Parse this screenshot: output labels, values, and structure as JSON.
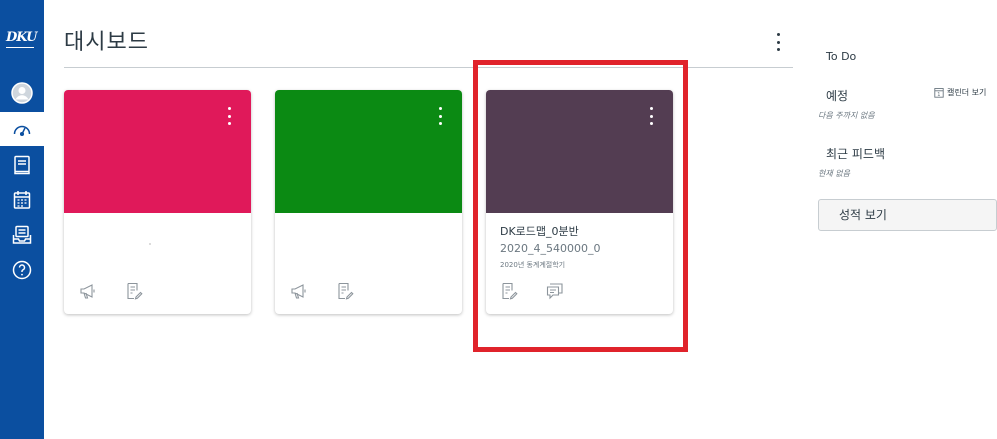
{
  "nav": {
    "logo_text": "DKU",
    "items": [
      {
        "icon": "account-icon"
      },
      {
        "icon": "dashboard-icon"
      },
      {
        "icon": "courses-icon"
      },
      {
        "icon": "calendar-icon"
      },
      {
        "icon": "inbox-icon"
      },
      {
        "icon": "help-icon"
      }
    ],
    "bg_color": "#0b4fa0"
  },
  "header": {
    "title": "대시보드"
  },
  "cards": [
    {
      "color": "#e0195a",
      "name": "",
      "code": "",
      "term": "",
      "icons": [
        "announcements-icon",
        "assignments-icon"
      ]
    },
    {
      "color": "#0b8a13",
      "name": "",
      "code": "",
      "term": "",
      "icons": [
        "announcements-icon",
        "assignments-icon"
      ]
    },
    {
      "color": "#533d52",
      "name": "DK로드맵_0분반",
      "code": "2020_4_540000_0",
      "term": "2020년 동계계절학기",
      "icons": [
        "assignments-icon",
        "discussions-icon"
      ]
    }
  ],
  "sidebar": {
    "todo_title": "To Do",
    "upcoming_title": "예정",
    "calendar_link": "캘린더 보기",
    "upcoming_empty": "다음 주까지 없음",
    "feedback_title": "최근 피드백",
    "feedback_empty": "현재 없음",
    "grades_button": "성적 보기"
  },
  "highlight_color": "#e0232b"
}
